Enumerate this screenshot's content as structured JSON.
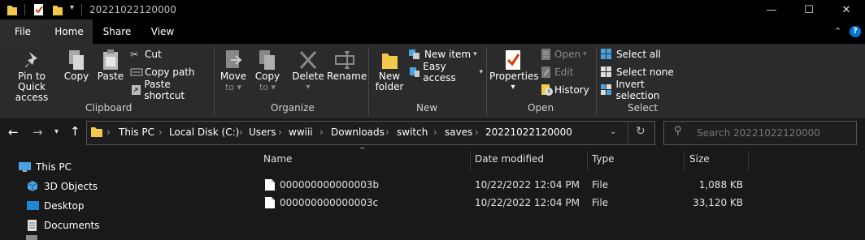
{
  "window": {
    "title": "20221022120000",
    "controls": {
      "minimize": "—",
      "maximize": "☐",
      "close": "✕"
    }
  },
  "ribbon_tabs": [
    {
      "label": "File"
    },
    {
      "label": "Home"
    },
    {
      "label": "Share"
    },
    {
      "label": "View"
    }
  ],
  "clipboard": {
    "pin_label_1": "Pin to Quick",
    "pin_label_2": "access",
    "copy": "Copy",
    "paste": "Paste",
    "cut": "Cut",
    "copy_path": "Copy path",
    "paste_shortcut": "Paste shortcut",
    "group": "Clipboard"
  },
  "organize": {
    "move_to_1": "Move",
    "move_to_2": "to",
    "copy_to_1": "Copy",
    "copy_to_2": "to",
    "delete": "Delete",
    "rename": "Rename",
    "group": "Organize"
  },
  "new": {
    "new_folder_1": "New",
    "new_folder_2": "folder",
    "new_item": "New item",
    "easy_access": "Easy access",
    "group": "New"
  },
  "open": {
    "properties": "Properties",
    "open": "Open",
    "edit": "Edit",
    "history": "History",
    "group": "Open"
  },
  "select": {
    "select_all": "Select all",
    "select_none": "Select none",
    "invert_selection": "Invert selection",
    "group": "Select"
  },
  "address": {
    "crumbs": [
      "This PC",
      "Local Disk (C:)",
      "Users",
      "wwiii",
      "Downloads",
      "switch",
      "saves",
      "20221022120000"
    ],
    "search_placeholder": "Search 20221022120000"
  },
  "nav_pane": [
    {
      "label": "This PC"
    },
    {
      "label": "3D Objects"
    },
    {
      "label": "Desktop"
    },
    {
      "label": "Documents"
    }
  ],
  "columns": {
    "name": "Name",
    "date_modified": "Date modified",
    "type": "Type",
    "size": "Size"
  },
  "files": [
    {
      "name": "000000000000003b",
      "date": "10/22/2022 12:04 PM",
      "type": "File",
      "size": "1,088 KB"
    },
    {
      "name": "000000000000003c",
      "date": "10/22/2022 12:04 PM",
      "type": "File",
      "size": "33,120 KB"
    }
  ],
  "colors": {
    "folder": "#f2c94c",
    "accent": "#0078d7"
  }
}
